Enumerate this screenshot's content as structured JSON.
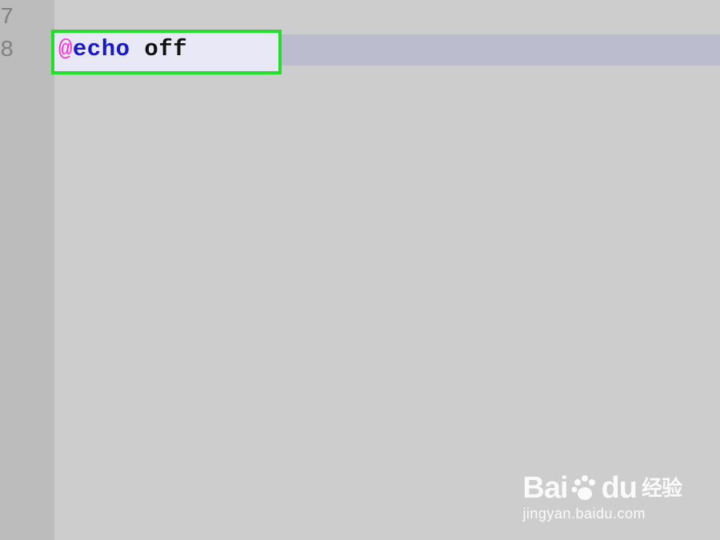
{
  "editor": {
    "line_numbers": [
      "7",
      "8"
    ],
    "code": {
      "at_symbol": "@",
      "keyword": "echo",
      "rest": " off"
    },
    "colors": {
      "background": "#cdcdcd",
      "gutter": "#bcbcbc",
      "current_line": "#bcbccf",
      "highlight_border": "#22e02a",
      "at_symbol": "#ff2fd0",
      "keyword": "#1818c8"
    }
  },
  "watermark": {
    "logo_left": "Bai",
    "logo_right": "du",
    "logo_cn": "经验",
    "url": "jingyan.baidu.com",
    "icon": "paw-icon"
  }
}
